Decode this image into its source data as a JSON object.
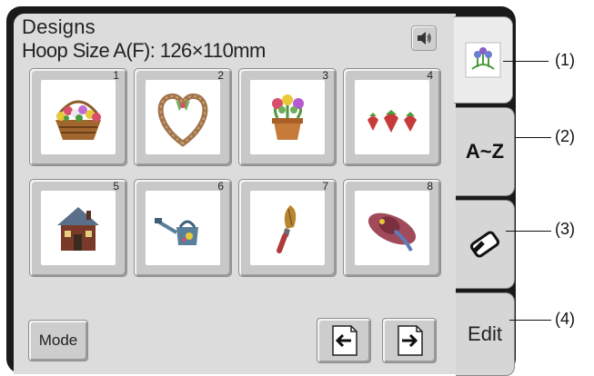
{
  "header": {
    "title": "Designs",
    "hoop_size": "Hoop Size  A(F): 126×110mm"
  },
  "icons": {
    "sound": "speaker-icon",
    "pattern_tab": "flower-embroidery-icon",
    "eraser": "eraser-icon",
    "prev": "page-prev-icon",
    "next": "page-next-icon"
  },
  "designs": [
    {
      "number": "1",
      "name": "flower-basket-icon"
    },
    {
      "number": "2",
      "name": "heart-wreath-icon"
    },
    {
      "number": "3",
      "name": "flower-pot-icon"
    },
    {
      "number": "4",
      "name": "strawberries-icon"
    },
    {
      "number": "5",
      "name": "house-icon"
    },
    {
      "number": "6",
      "name": "watering-can-icon"
    },
    {
      "number": "7",
      "name": "trowel-icon"
    },
    {
      "number": "8",
      "name": "sun-hat-icon"
    }
  ],
  "buttons": {
    "mode": "Mode"
  },
  "tabs": {
    "sort": "A~Z",
    "edit": "Edit"
  },
  "callouts": [
    "(1)",
    "(2)",
    "(3)",
    "(4)"
  ],
  "colors": {
    "panel": "#dcdcdc",
    "frame": "#1a1a1a",
    "tile": "#c8c8c8"
  }
}
